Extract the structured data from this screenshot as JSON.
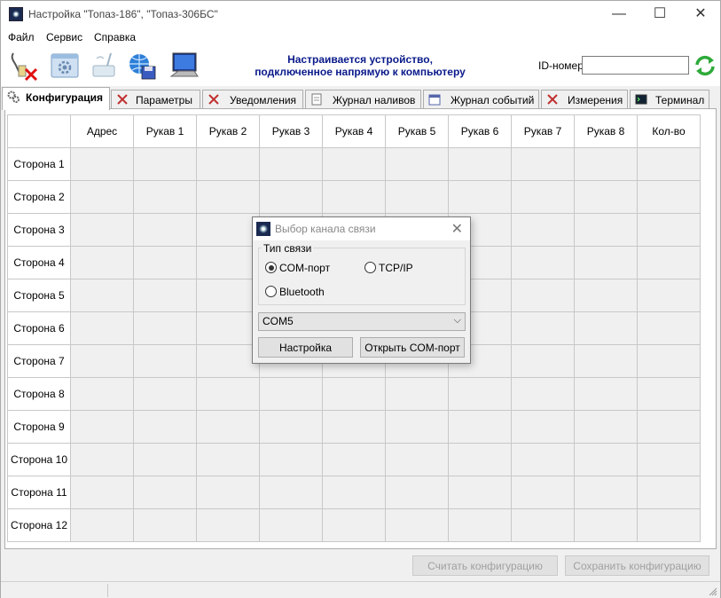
{
  "window": {
    "title": "Настройка \"Топаз-186\", \"Топаз-306БС\"",
    "minimize": "—",
    "maximize": "☐",
    "close": "✕"
  },
  "menu": {
    "items": [
      "Файл",
      "Сервис",
      "Справка"
    ]
  },
  "toolbar": {
    "status_line1": "Настраивается устройство,",
    "status_line2": "подключенное напрямую к компьютеру",
    "id_label": "ID-номер",
    "id_value": ""
  },
  "tabs": [
    {
      "label": "Конфигурация",
      "icon": "gears-icon",
      "active": true
    },
    {
      "label": "Параметры",
      "icon": "tools-icon"
    },
    {
      "label": "Уведомления",
      "icon": "tools-icon"
    },
    {
      "label": "Журнал наливов",
      "icon": "document-icon"
    },
    {
      "label": "Журнал событий",
      "icon": "calendar-icon"
    },
    {
      "label": "Измерения",
      "icon": "tools-icon"
    },
    {
      "label": "Терминал",
      "icon": "terminal-icon"
    }
  ],
  "grid": {
    "columns": [
      "Адрес",
      "Рукав 1",
      "Рукав 2",
      "Рукав 3",
      "Рукав 4",
      "Рукав 5",
      "Рукав 6",
      "Рукав 7",
      "Рукав 8",
      "Кол-во"
    ],
    "rows": [
      "Сторона 1",
      "Сторона 2",
      "Сторона 3",
      "Сторона 4",
      "Сторона 5",
      "Сторона 6",
      "Сторона 7",
      "Сторона 8",
      "Сторона 9",
      "Сторона 10",
      "Сторона 11",
      "Сторона 12"
    ]
  },
  "bottom": {
    "read_config": "Считать конфигурацию",
    "save_config": "Сохранить конфигурацию"
  },
  "dialog": {
    "title": "Выбор канала связи",
    "group_label": "Тип связи",
    "radio_com": "COM-порт",
    "radio_tcp": "TCP/IP",
    "radio_bt": "Bluetooth",
    "selected": "COM-порт",
    "port_value": "COM5",
    "setup_button": "Настройка",
    "open_button": "Открыть COM-порт"
  },
  "colors": {
    "accent_text": "#0a1a8a",
    "refresh": "#2eaa3a"
  }
}
